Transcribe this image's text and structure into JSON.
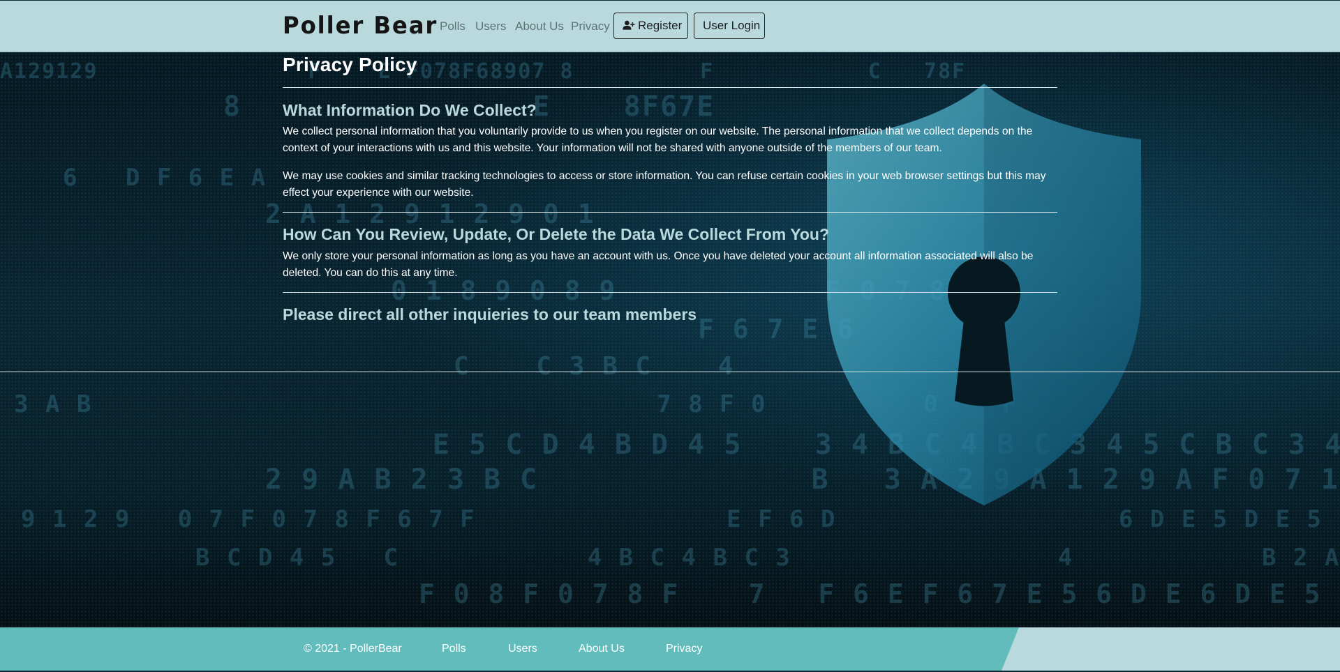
{
  "navbar": {
    "brand": "Poller Bear",
    "links": [
      "Polls",
      "Users",
      "About Us",
      "Privacy"
    ],
    "register_label": "Register",
    "register_icon": "user-plus-icon",
    "login_label": "User Login"
  },
  "content": {
    "title": "Privacy Policy",
    "sections": [
      {
        "heading": "What Information Do We Collect?",
        "paragraphs": [
          "We collect personal information that you voluntarily provide to us when you register on our website. The personal information that we collect depends on the context of your interactions with us and this website. Your information will not be shared with anyone outside of the members of our team.",
          "We may use cookies and similar tracking technologies to access or store information. You can refuse certain cookies in your web browser settings but this may effect your experience with our website."
        ]
      },
      {
        "heading": "How Can You Review, Update, Or Delete the Data We Collect From You?",
        "paragraphs": [
          "We only store your personal information as long as you have an account with us. Once you have deleted your account all information associated will also be deleted. You can do this at any time."
        ]
      },
      {
        "heading": "Please direct all other inquieries to our team members",
        "paragraphs": []
      }
    ]
  },
  "footer": {
    "copyright": "© 2021 - PollerBear",
    "links": [
      "Polls",
      "Users",
      "About Us",
      "Privacy"
    ]
  },
  "colors": {
    "navbar_bg": "#b9d9dd",
    "footer_band": "#63bcbc",
    "heading": "#b9d9dd",
    "background": "#041218"
  }
}
